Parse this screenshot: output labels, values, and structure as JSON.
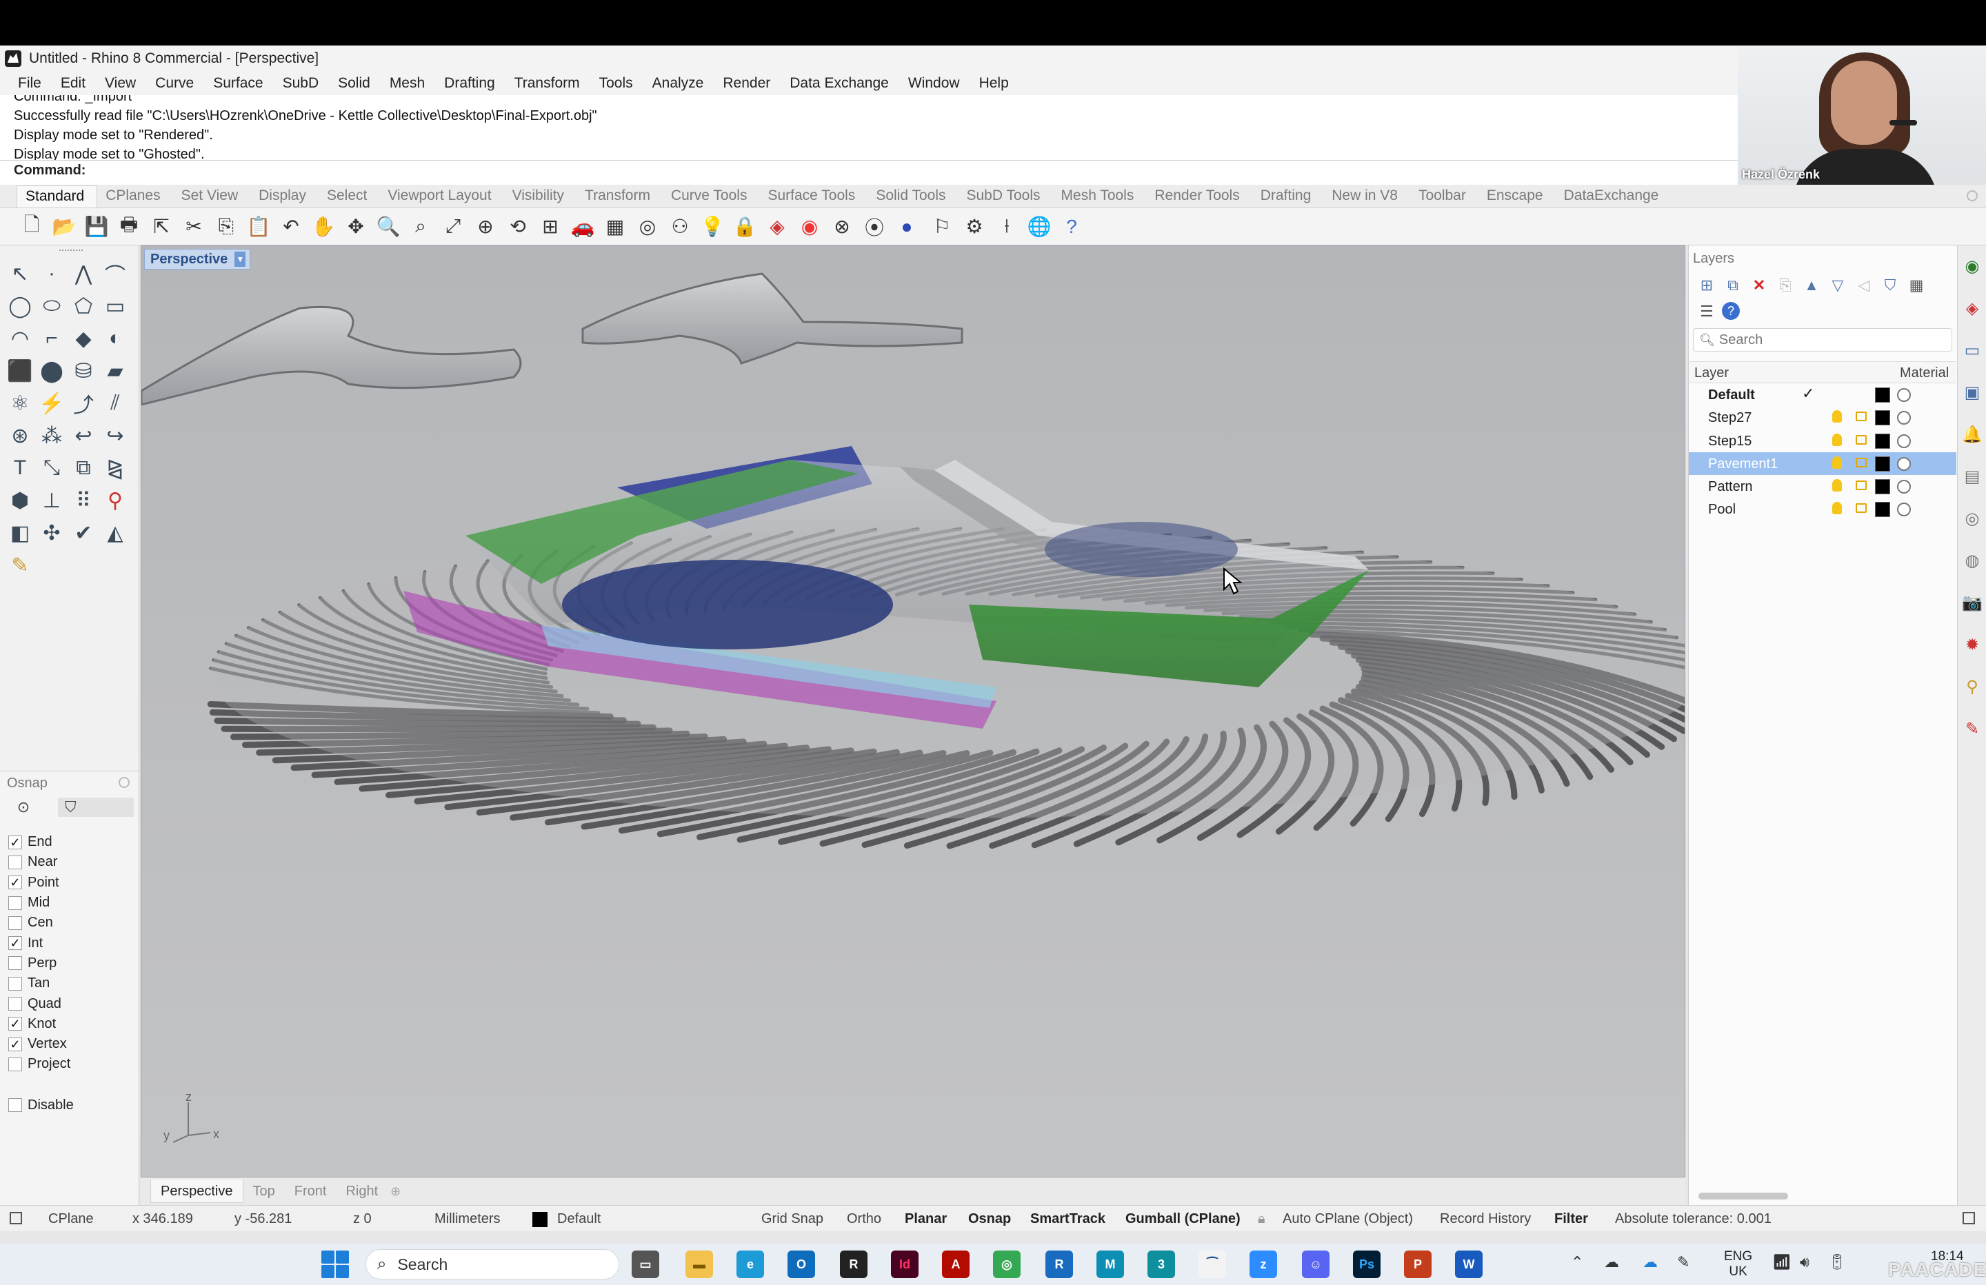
{
  "window": {
    "title": "Untitled - Rhino 8 Commercial - [Perspective]"
  },
  "menu": [
    "File",
    "Edit",
    "View",
    "Curve",
    "Surface",
    "SubD",
    "Solid",
    "Mesh",
    "Drafting",
    "Transform",
    "Tools",
    "Analyze",
    "Render",
    "Data Exchange",
    "Window",
    "Help"
  ],
  "command_history": [
    "Command: _Import",
    "Successfully read file \"C:\\Users\\HOzrenk\\OneDrive - Kettle Collective\\Desktop\\Final-Export.obj\"",
    "Display mode set to \"Rendered\".",
    "Display mode set to \"Ghosted\"."
  ],
  "command_prompt": {
    "label": "Command:",
    "value": ""
  },
  "webcam": {
    "name": "Hazel Özrenk"
  },
  "toolbar_tabs": [
    "Standard",
    "CPlanes",
    "Set View",
    "Display",
    "Select",
    "Viewport Layout",
    "Visibility",
    "Transform",
    "Curve Tools",
    "Surface Tools",
    "Solid Tools",
    "SubD Tools",
    "Mesh Tools",
    "Render Tools",
    "Drafting",
    "New in V8",
    "Toolbar",
    "Enscape",
    "DataExchange"
  ],
  "active_toolbar_tab": "Standard",
  "viewport": {
    "title": "Perspective",
    "axis_labels": {
      "z": "z",
      "y": "y",
      "x": "x"
    }
  },
  "viewport_tabs": [
    "Perspective",
    "Top",
    "Front",
    "Right"
  ],
  "osnap": {
    "title": "Osnap",
    "items": [
      {
        "label": "End",
        "checked": true
      },
      {
        "label": "Near",
        "checked": false
      },
      {
        "label": "Point",
        "checked": true
      },
      {
        "label": "Mid",
        "checked": false
      },
      {
        "label": "Cen",
        "checked": false
      },
      {
        "label": "Int",
        "checked": true
      },
      {
        "label": "Perp",
        "checked": false
      },
      {
        "label": "Tan",
        "checked": false
      },
      {
        "label": "Quad",
        "checked": false
      },
      {
        "label": "Knot",
        "checked": true
      },
      {
        "label": "Vertex",
        "checked": true
      },
      {
        "label": "Project",
        "checked": false
      }
    ],
    "disable_label": "Disable",
    "disable_checked": false
  },
  "layers": {
    "title": "Layers",
    "search_placeholder": "Search",
    "col_layer": "Layer",
    "col_material": "Material",
    "rows": [
      {
        "name": "Default",
        "current": true,
        "selected": false,
        "bold": true
      },
      {
        "name": "Step27",
        "current": false,
        "selected": false,
        "bold": false
      },
      {
        "name": "Step15",
        "current": false,
        "selected": false,
        "bold": false
      },
      {
        "name": "Pavement1",
        "current": false,
        "selected": true,
        "bold": false
      },
      {
        "name": "Pattern",
        "current": false,
        "selected": false,
        "bold": false
      },
      {
        "name": "Pool",
        "current": false,
        "selected": false,
        "bold": false
      }
    ]
  },
  "status_bar": {
    "cplane": "CPlane",
    "x": "x 346.189",
    "y": "y -56.281",
    "z": "z 0",
    "units": "Millimeters",
    "layer": "Default",
    "grid_snap": "Grid Snap",
    "ortho": "Ortho",
    "planar": "Planar",
    "osnap": "Osnap",
    "smarttrack": "SmartTrack",
    "gumball": "Gumball (CPlane)",
    "auto_cplane": "Auto CPlane (Object)",
    "record_history": "Record History",
    "filter": "Filter",
    "tolerance": "Absolute tolerance: 0.001"
  },
  "taskbar": {
    "search_placeholder": "Search",
    "lang_line1": "ENG",
    "lang_line2": "UK",
    "time": "18:14",
    "watermark": "PAACADEMY"
  },
  "colors": {
    "accent": "#1d7fd8",
    "layer_selected": "#9cc1f0",
    "viewport_bg": "#bbbcbe",
    "green_volume": "#3f9a3f",
    "blue_pool": "#2b3b7a",
    "magenta_edge": "#b13fb6"
  }
}
